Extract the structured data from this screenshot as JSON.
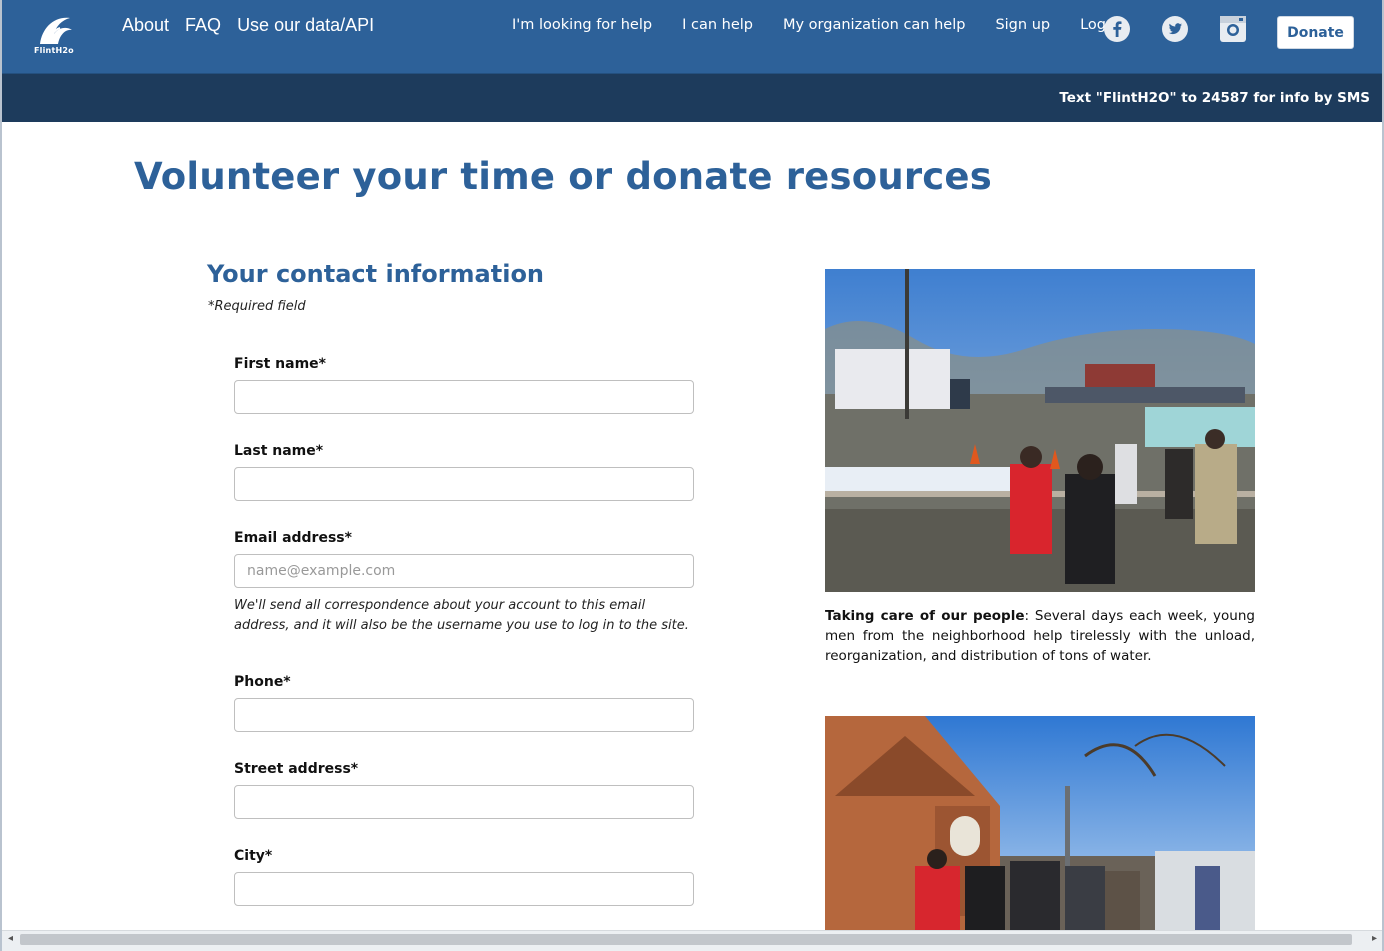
{
  "header": {
    "logo_text": "FlintH2o",
    "nav_main": [
      "About",
      "FAQ",
      "Use our data/API"
    ],
    "nav_right": [
      "I'm looking for help",
      "I can help",
      "My organization can help",
      "Sign up",
      "Log in"
    ],
    "social_icons": [
      "facebook-icon",
      "twitter-icon",
      "instagram-icon"
    ],
    "donate_label": "Donate",
    "brand_color": "#2d6199"
  },
  "sms_bar": {
    "text": "Text \"FlintH2O\" to 24587 for info by SMS"
  },
  "page_title": "Volunteer your time or donate resources",
  "form": {
    "section_title": "Your contact information",
    "required_note": "*Required field",
    "fields": [
      {
        "label": "First name*",
        "value": "",
        "placeholder": ""
      },
      {
        "label": "Last name*",
        "value": "",
        "placeholder": ""
      },
      {
        "label": "Email address*",
        "value": "",
        "placeholder": "name@example.com"
      },
      {
        "label": "Phone*",
        "value": "",
        "placeholder": ""
      },
      {
        "label": "Street address*",
        "value": "",
        "placeholder": ""
      },
      {
        "label": "City*",
        "value": "",
        "placeholder": ""
      }
    ],
    "email_help": "We'll send all correspondence about your account to this email address, and it will also be the username you use to log in to the site."
  },
  "photos": {
    "caption_bold": "Taking care of our people",
    "caption_rest": ": Several days each week, young men from the neighborhood help tirelessly with the unload, reorganization, and distribution of tons of water."
  }
}
